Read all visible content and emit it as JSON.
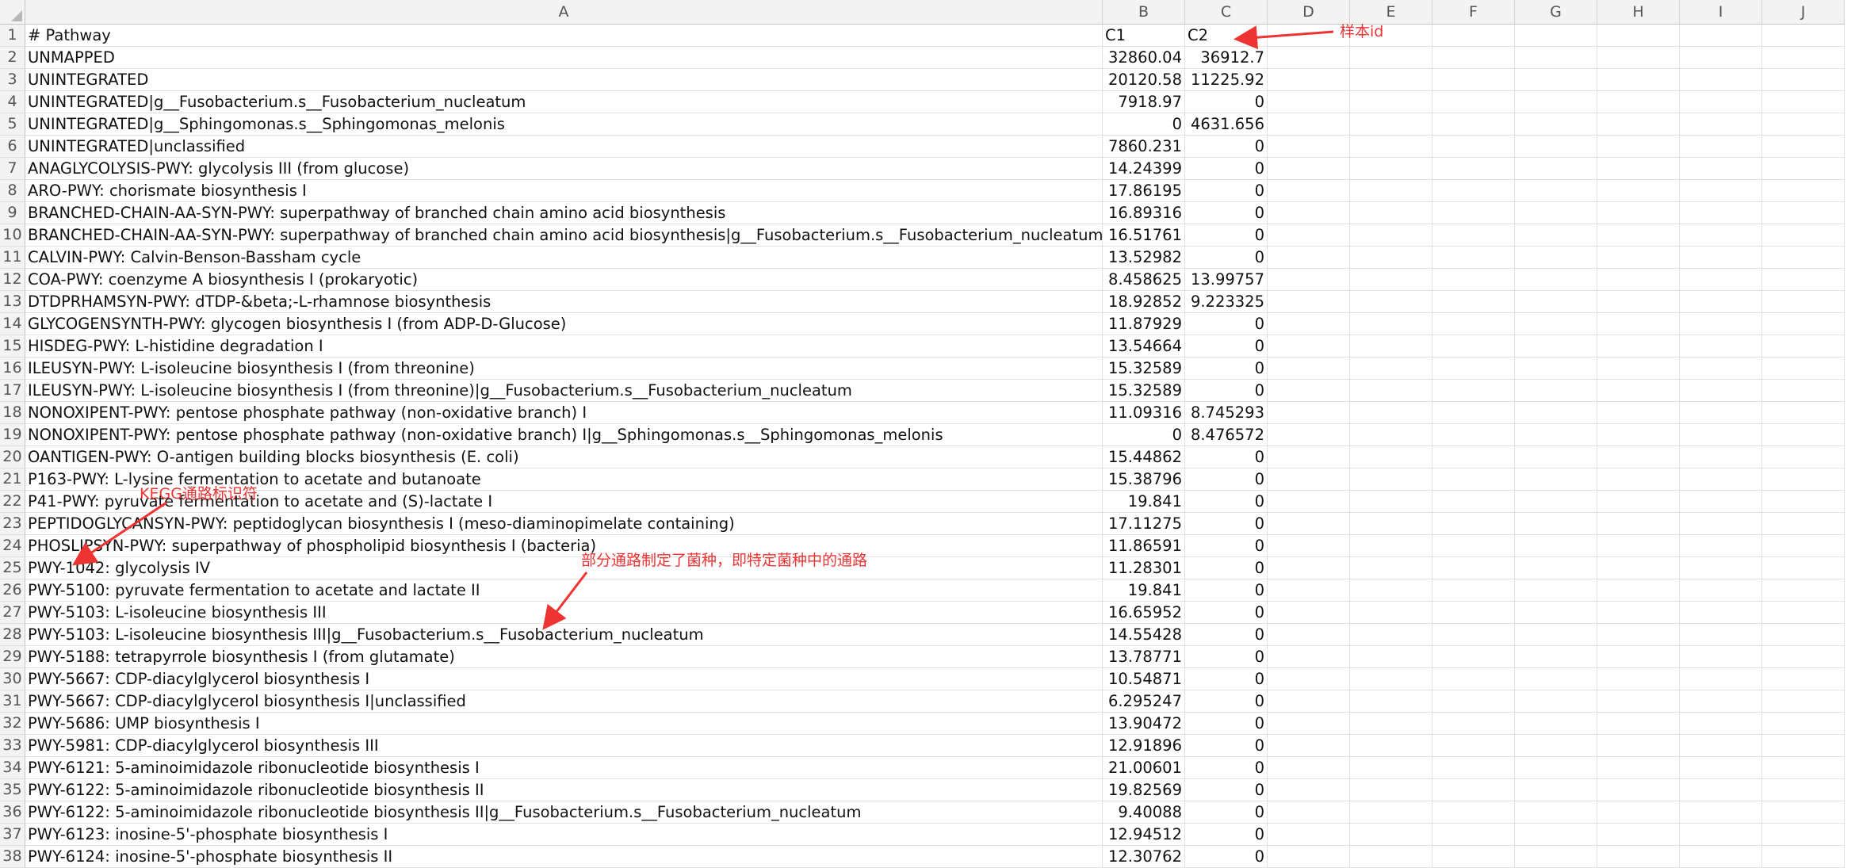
{
  "columns": [
    "A",
    "B",
    "C",
    "D",
    "E",
    "F",
    "G",
    "H",
    "I",
    "J"
  ],
  "rows": [
    [
      "# Pathway",
      "C1",
      "C2"
    ],
    [
      "UNMAPPED",
      "32860.04",
      "36912.7"
    ],
    [
      "UNINTEGRATED",
      "20120.58",
      "11225.92"
    ],
    [
      "UNINTEGRATED|g__Fusobacterium.s__Fusobacterium_nucleatum",
      "7918.97",
      "0"
    ],
    [
      "UNINTEGRATED|g__Sphingomonas.s__Sphingomonas_melonis",
      "0",
      "4631.656"
    ],
    [
      "UNINTEGRATED|unclassified",
      "7860.231",
      "0"
    ],
    [
      "ANAGLYCOLYSIS-PWY: glycolysis III (from glucose)",
      "14.24399",
      "0"
    ],
    [
      "ARO-PWY: chorismate biosynthesis I",
      "17.86195",
      "0"
    ],
    [
      "BRANCHED-CHAIN-AA-SYN-PWY: superpathway of branched chain amino acid biosynthesis",
      "16.89316",
      "0"
    ],
    [
      "BRANCHED-CHAIN-AA-SYN-PWY: superpathway of branched chain amino acid biosynthesis|g__Fusobacterium.s__Fusobacterium_nucleatum",
      "16.51761",
      "0"
    ],
    [
      "CALVIN-PWY: Calvin-Benson-Bassham cycle",
      "13.52982",
      "0"
    ],
    [
      "COA-PWY: coenzyme A biosynthesis I (prokaryotic)",
      "8.458625",
      "13.99757"
    ],
    [
      "DTDPRHAMSYN-PWY: dTDP-&beta;-L-rhamnose biosynthesis",
      "18.92852",
      "9.223325"
    ],
    [
      "GLYCOGENSYNTH-PWY: glycogen biosynthesis I (from ADP-D-Glucose)",
      "11.87929",
      "0"
    ],
    [
      "HISDEG-PWY: L-histidine degradation I",
      "13.54664",
      "0"
    ],
    [
      "ILEUSYN-PWY: L-isoleucine biosynthesis I (from threonine)",
      "15.32589",
      "0"
    ],
    [
      "ILEUSYN-PWY: L-isoleucine biosynthesis I (from threonine)|g__Fusobacterium.s__Fusobacterium_nucleatum",
      "15.32589",
      "0"
    ],
    [
      "NONOXIPENT-PWY: pentose phosphate pathway (non-oxidative branch) I",
      "11.09316",
      "8.745293"
    ],
    [
      "NONOXIPENT-PWY: pentose phosphate pathway (non-oxidative branch) I|g__Sphingomonas.s__Sphingomonas_melonis",
      "0",
      "8.476572"
    ],
    [
      "OANTIGEN-PWY: O-antigen building blocks biosynthesis (E. coli)",
      "15.44862",
      "0"
    ],
    [
      "P163-PWY: L-lysine fermentation to acetate and butanoate",
      "15.38796",
      "0"
    ],
    [
      "P41-PWY: pyruvate fermentation to acetate and (S)-lactate I",
      "19.841",
      "0"
    ],
    [
      "PEPTIDOGLYCANSYN-PWY: peptidoglycan biosynthesis I (meso-diaminopimelate containing)",
      "17.11275",
      "0"
    ],
    [
      "PHOSLIPSYN-PWY: superpathway of phospholipid biosynthesis I (bacteria)",
      "11.86591",
      "0"
    ],
    [
      "PWY-1042: glycolysis IV",
      "11.28301",
      "0"
    ],
    [
      "PWY-5100: pyruvate fermentation to acetate and lactate II",
      "19.841",
      "0"
    ],
    [
      "PWY-5103: L-isoleucine biosynthesis III",
      "16.65952",
      "0"
    ],
    [
      "PWY-5103: L-isoleucine biosynthesis III|g__Fusobacterium.s__Fusobacterium_nucleatum",
      "14.55428",
      "0"
    ],
    [
      "PWY-5188: tetrapyrrole biosynthesis I (from glutamate)",
      "13.78771",
      "0"
    ],
    [
      "PWY-5667: CDP-diacylglycerol biosynthesis I",
      "10.54871",
      "0"
    ],
    [
      "PWY-5667: CDP-diacylglycerol biosynthesis I|unclassified",
      "6.295247",
      "0"
    ],
    [
      "PWY-5686: UMP biosynthesis I",
      "13.90472",
      "0"
    ],
    [
      "PWY-5981: CDP-diacylglycerol biosynthesis III",
      "12.91896",
      "0"
    ],
    [
      "PWY-6121: 5-aminoimidazole ribonucleotide biosynthesis I",
      "21.00601",
      "0"
    ],
    [
      "PWY-6122: 5-aminoimidazole ribonucleotide biosynthesis II",
      "19.82569",
      "0"
    ],
    [
      "PWY-6122: 5-aminoimidazole ribonucleotide biosynthesis II|g__Fusobacterium.s__Fusobacterium_nucleatum",
      "9.40088",
      "0"
    ],
    [
      "PWY-6123: inosine-5'-phosphate biosynthesis I",
      "12.94512",
      "0"
    ],
    [
      "PWY-6124: inosine-5'-phosphate biosynthesis II",
      "12.30762",
      "0"
    ]
  ],
  "annotations": {
    "sample_id": "样本id",
    "kegg_id": "KEGG通路标识符",
    "strain_pathway": "部分通路制定了菌种，即特定菌种中的通路"
  },
  "colors": {
    "annotation": "#ee3333",
    "header_bg": "#f3f3f3",
    "grid": "#e1e1e1"
  }
}
